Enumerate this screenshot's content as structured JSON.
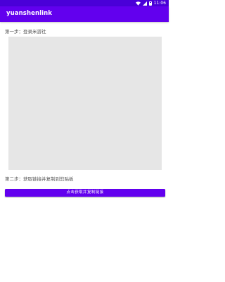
{
  "status_bar": {
    "time": "11:06",
    "icons": [
      "wifi-icon",
      "signal-icon",
      "battery-icon"
    ]
  },
  "app_bar": {
    "title": "yuanshenlink",
    "color": "#6200ee"
  },
  "step1": {
    "label": "第一步：登录米游社"
  },
  "step2": {
    "label": "第二步：获取链接并复制到剪贴板"
  },
  "action": {
    "button_label": "点击获取并复制链接"
  },
  "colors": {
    "primary": "#6200ee",
    "status_bar": "#4a00d8",
    "webview_bg": "#e6e6e6"
  }
}
